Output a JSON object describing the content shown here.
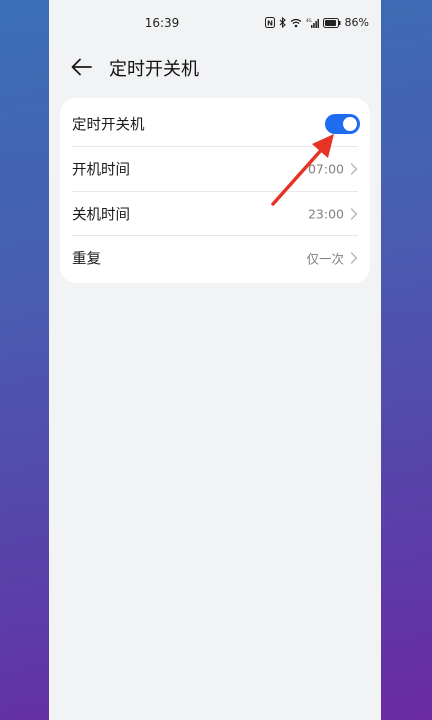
{
  "status_bar": {
    "time": "16:39",
    "battery": "86%"
  },
  "header": {
    "title": "定时开关机",
    "back_icon": "arrow-left-icon"
  },
  "settings": {
    "toggle_row": {
      "label": "定时开关机",
      "enabled": true,
      "accent_color": "#1f6cf0"
    },
    "power_on": {
      "label": "开机时间",
      "value": "07:00"
    },
    "power_off": {
      "label": "关机时间",
      "value": "23:00"
    },
    "repeat": {
      "label": "重复",
      "value": "仅一次"
    }
  },
  "annotation": {
    "arrow_color": "#e53326"
  }
}
